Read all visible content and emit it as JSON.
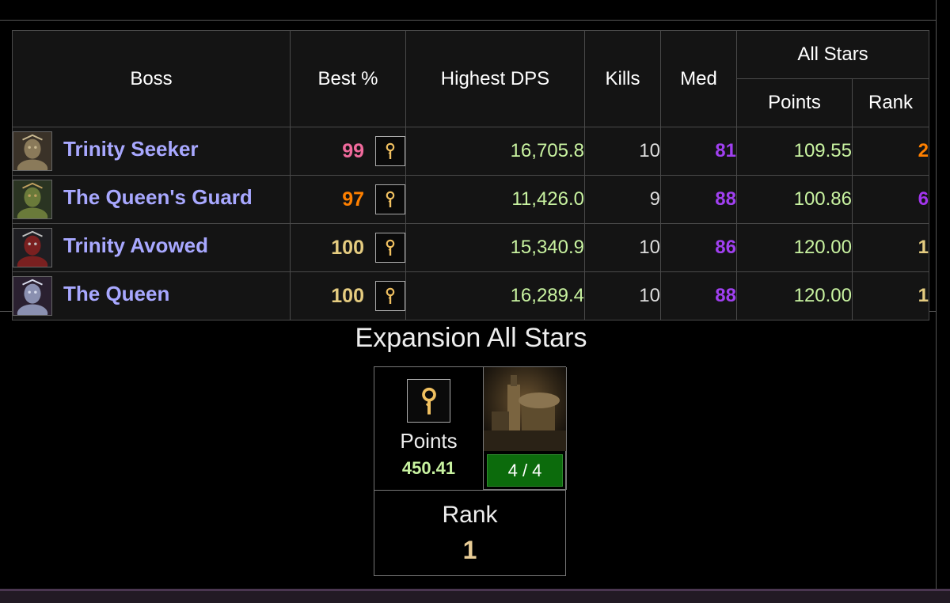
{
  "table": {
    "headers": {
      "boss": "Boss",
      "best": "Best %",
      "dps": "Highest DPS",
      "kills": "Kills",
      "med": "Med",
      "all_stars": "All Stars",
      "points": "Points",
      "rank": "Rank"
    },
    "rows": [
      {
        "boss": "Trinity Seeker",
        "portrait": "boss-portrait-trinity-seeker",
        "best": "99",
        "best_color": "#f06a9c",
        "dps": "16,705.8",
        "kills": "10",
        "med": "81",
        "points": "109.55",
        "rank": "2",
        "rank_color": "#ff8000"
      },
      {
        "boss": "The Queen's Guard",
        "portrait": "boss-portrait-queens-guard",
        "best": "97",
        "best_color": "#ff8000",
        "dps": "11,426.0",
        "kills": "9",
        "med": "88",
        "points": "100.86",
        "rank": "6",
        "rank_color": "#a335ee"
      },
      {
        "boss": "Trinity Avowed",
        "portrait": "boss-portrait-trinity-avowed",
        "best": "100",
        "best_color": "#e5cc80",
        "dps": "15,340.9",
        "kills": "10",
        "med": "86",
        "points": "120.00",
        "rank": "1",
        "rank_color": "#e5cc80"
      },
      {
        "boss": "The Queen",
        "portrait": "boss-portrait-the-queen",
        "best": "100",
        "best_color": "#e5cc80",
        "dps": "16,289.4",
        "kills": "10",
        "med": "88",
        "points": "120.00",
        "rank": "1",
        "rank_color": "#e5cc80"
      }
    ],
    "star_icon": "all-stars-icon"
  },
  "expansion": {
    "title": "Expansion All Stars",
    "points_label": "Points",
    "points_value": "450.41",
    "progress": "4 / 4",
    "progress_fraction": 1.0,
    "progress_color": "#0c6b0c",
    "zone_image": "zone-image",
    "rank_label": "Rank",
    "rank_value": "1"
  }
}
